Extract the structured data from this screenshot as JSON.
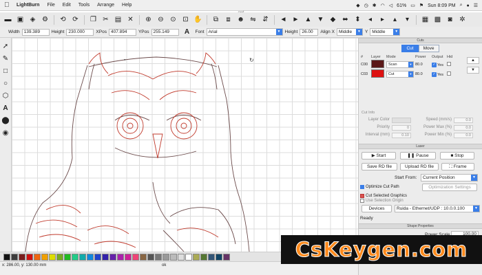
{
  "menubar": {
    "app_name": "LightBurn",
    "menus": [
      "File",
      "Edit",
      "Tools",
      "Arrange",
      "Help"
    ],
    "battery": "61%",
    "clock": "Sun 8:09 PM"
  },
  "window_title": "owl",
  "props": {
    "width_label": "Width",
    "width_value": "139.389",
    "height_label": "Height",
    "height_value": "230.000",
    "xpos_label": "XPos",
    "xpos_value": "407.894",
    "ypos_label": "YPos",
    "ypos_value": "255.149",
    "font_label": "Font",
    "font_value": "Arial",
    "fheight_label": "Height",
    "fheight_value": "26.00",
    "alignx_label": "Align X",
    "alignx_value": "Middle",
    "aligny_label": "Y",
    "aligny_value": "Middle"
  },
  "panel": {
    "cuts_header": "Cuts",
    "tab_cut": "Cut",
    "tab_move": "Move",
    "col_num": "#",
    "col_layer": "Layer",
    "col_mode": "Mode",
    "col_power": "Power",
    "col_output": "Output",
    "col_hide": "Hid",
    "layers": [
      {
        "num": "C00",
        "color": "#5a1818",
        "mode": "Scan",
        "power": "80.0",
        "output": "Yes"
      },
      {
        "num": "C03",
        "color": "#dd1111",
        "mode": "Cut",
        "power": "80.0",
        "output": "Yes"
      }
    ],
    "cut_info": "Cut Info",
    "layer_color_label": "Layer Color",
    "priority_label": "Priority",
    "priority_value": "0",
    "interval_label": "Interval (mm)",
    "interval_value": "0.10",
    "speed_label": "Speed (mm/s)",
    "speed_value": "0.0",
    "powermax_label": "Power Max (%)",
    "powermax_value": "0.0",
    "powermin_label": "Power Min (%)",
    "powermin_value": "0.0",
    "laser_header": "Laser",
    "start": "Start",
    "pause": "Pause",
    "stop": "Stop",
    "save_rd": "Save RD file",
    "upload_rd": "Upload RD file",
    "frame": "Frame",
    "start_from_label": "Start From:",
    "start_from_value": "Current Position",
    "optimize": "Optimize Cut Path",
    "optimization_settings": "Optimization Settings",
    "cut_selected": "Cut Selected Graphics",
    "use_origin": "Use Selection Origin",
    "devices": "Devices",
    "device_value": "Ruida - Ethernet/UDP : 10.0.0.100",
    "ready": "Ready",
    "shape_header": "Shape Properties",
    "power_scale_label": "Power Scale",
    "power_scale_value": "100.00"
  },
  "status": {
    "coords": "x: 286.00, y: 130.00 mm",
    "ok": "ok"
  },
  "palette": [
    "#111111",
    "#3d3d3d",
    "#7a1e1e",
    "#d01111",
    "#ee6611",
    "#f0a000",
    "#dddd00",
    "#77aa22",
    "#22bb22",
    "#22cc88",
    "#11aaaa",
    "#1188dd",
    "#2244cc",
    "#3322aa",
    "#6622aa",
    "#aa22aa",
    "#cc2299",
    "#ee4477",
    "#886644",
    "#555555",
    "#777777",
    "#999999",
    "#bbbbbb",
    "#dddddd",
    "#ffffff",
    "#aaaa55",
    "#557733",
    "#335577",
    "#114466",
    "#663366"
  ],
  "brand_text": "CsKeygen.com",
  "colors": {
    "accent": "#3a7ee8",
    "owl_scan": "#6b4a4a",
    "owl_cut": "#c0392b"
  }
}
